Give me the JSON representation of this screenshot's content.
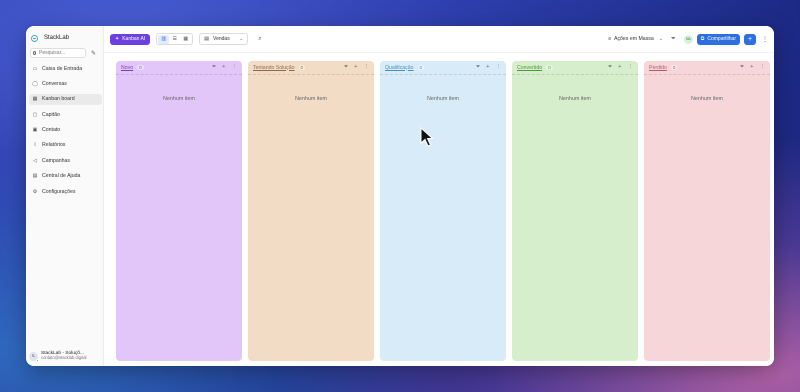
{
  "app": {
    "name": "StackLab"
  },
  "sidebar": {
    "search_placeholder": "Pesquisar...",
    "items": [
      {
        "label": "Caixa de Entrada",
        "icon": "inbox-icon",
        "active": false
      },
      {
        "label": "Conversas",
        "icon": "chat-icon",
        "active": false
      },
      {
        "label": "Kanban board",
        "icon": "kanban-icon",
        "active": true
      },
      {
        "label": "Capitão",
        "icon": "captain-icon",
        "active": false
      },
      {
        "label": "Contato",
        "icon": "contact-icon",
        "active": false
      },
      {
        "label": "Relatórios",
        "icon": "chart-icon",
        "active": false
      },
      {
        "label": "Campanhas",
        "icon": "megaphone-icon",
        "active": false
      },
      {
        "label": "Central de Ajuda",
        "icon": "book-icon",
        "active": false
      },
      {
        "label": "Configurações",
        "icon": "gear-icon",
        "active": false
      }
    ],
    "profile": {
      "initials": "S-",
      "name": "StackLab - Soluçõ...",
      "email": "contato@stacklab.digital"
    }
  },
  "toolbar": {
    "ai_button": "Kanban AI",
    "pipeline": "Vendas",
    "bulk_actions": "Ações em Massa",
    "avatar_initials": "NA",
    "share_button": "Compartilhar",
    "add_button": "+"
  },
  "columns": [
    {
      "title": "Novo",
      "count": "0",
      "empty_text": "Nenhum item",
      "bg": "#e2c6f9",
      "title_color": "#7a3fbd"
    },
    {
      "title": "Tentando Solução",
      "count": "0",
      "empty_text": "Nenhum item",
      "bg": "#f3dcc6",
      "title_color": "#8a6a4e"
    },
    {
      "title": "Qualificação",
      "count": "0",
      "empty_text": "Nenhum item",
      "bg": "#d7ebf8",
      "title_color": "#4f8fbf"
    },
    {
      "title": "Convertido",
      "count": "0",
      "empty_text": "Nenhum item",
      "bg": "#d6eecb",
      "title_color": "#4c9a3a"
    },
    {
      "title": "Perdido",
      "count": "0",
      "empty_text": "Nenhum item",
      "bg": "#f6d6d9",
      "title_color": "#b45a66"
    }
  ]
}
